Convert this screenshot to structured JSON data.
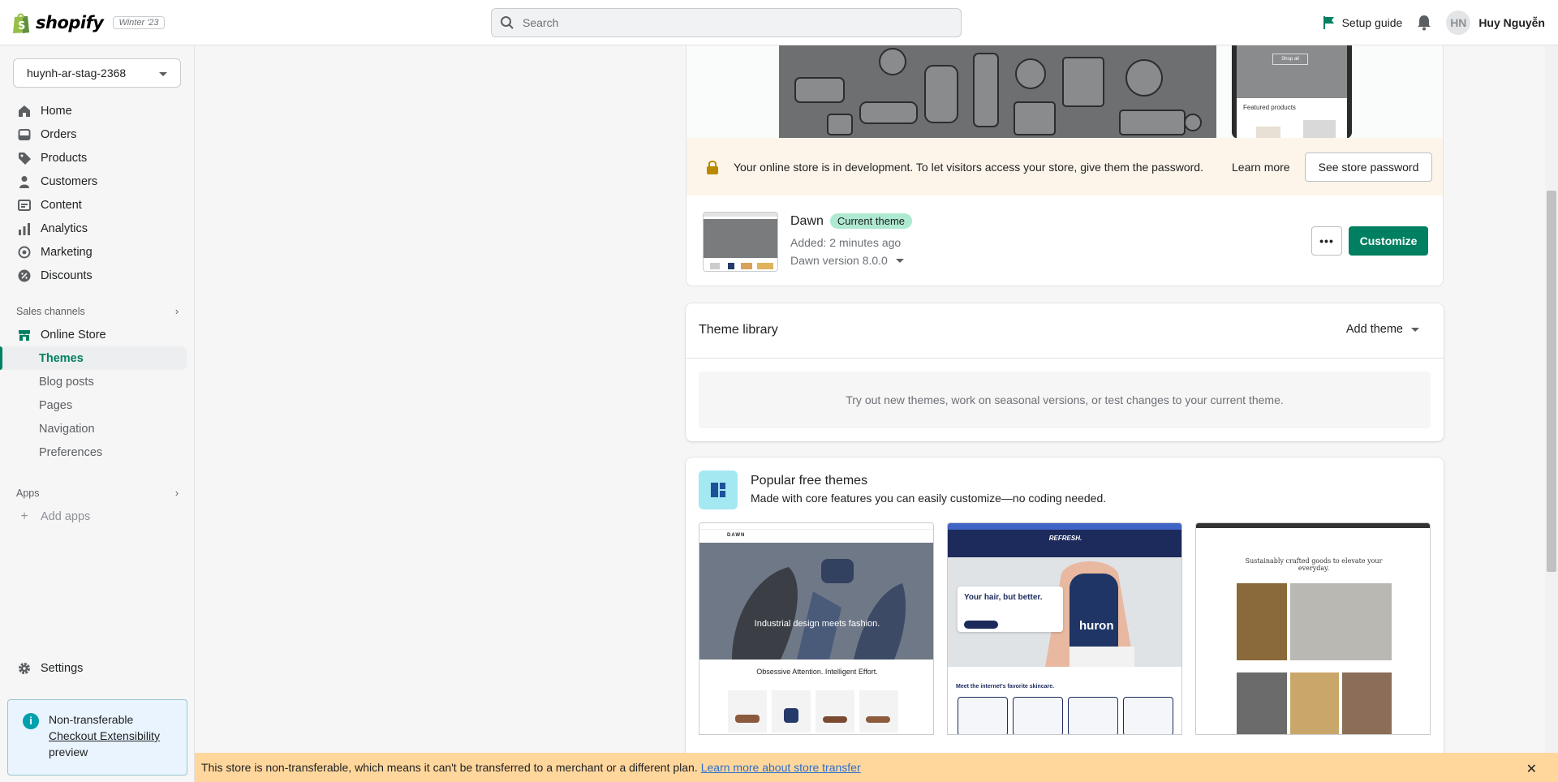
{
  "topbar": {
    "brand": "shopify",
    "edition": "Winter '23",
    "search_placeholder": "Search",
    "setup_guide": "Setup guide",
    "user_initials": "HN",
    "user_name": "Huy Nguyễn"
  },
  "sidebar": {
    "store_name": "huynh-ar-stag-2368",
    "items": [
      {
        "label": "Home",
        "icon": "home-icon"
      },
      {
        "label": "Orders",
        "icon": "orders-icon"
      },
      {
        "label": "Products",
        "icon": "tag-icon"
      },
      {
        "label": "Customers",
        "icon": "person-icon"
      },
      {
        "label": "Content",
        "icon": "content-icon"
      },
      {
        "label": "Analytics",
        "icon": "bar-chart-icon"
      },
      {
        "label": "Marketing",
        "icon": "target-icon"
      },
      {
        "label": "Discounts",
        "icon": "discount-icon"
      }
    ],
    "sales_channels_label": "Sales channels",
    "online_store": "Online Store",
    "sub_items": [
      "Themes",
      "Blog posts",
      "Pages",
      "Navigation",
      "Preferences"
    ],
    "apps_label": "Apps",
    "add_apps": "Add apps",
    "settings": "Settings",
    "notice": {
      "line1": "Non-transferable",
      "link": "Checkout Extensibility",
      "line3": "preview"
    }
  },
  "main": {
    "preview": {
      "mobile_button": "Shop all",
      "mobile_featured": "Featured products"
    },
    "dev_banner": {
      "message": "Your online store is in development. To let visitors access your store, give them the password.",
      "learn_more": "Learn more",
      "button": "See store password"
    },
    "current_theme": {
      "name": "Dawn",
      "badge": "Current theme",
      "added": "Added: 2 minutes ago",
      "version": "Dawn version 8.0.0",
      "customize": "Customize"
    },
    "library": {
      "title": "Theme library",
      "add_theme": "Add theme",
      "empty_text": "Try out new themes, work on seasonal versions, or test changes to your current theme."
    },
    "popular": {
      "title": "Popular free themes",
      "subtitle": "Made with core features you can easily customize—no coding needed.",
      "themes": [
        {
          "brand": "DAWN",
          "headline": "Industrial design meets fashion.",
          "tagline": "Obsessive Attention. Intelligent Effort."
        },
        {
          "brand": "REFRESH.",
          "headline": "Your hair, but better.",
          "product": "huron",
          "tagline": "Meet the internet's favorite skincare."
        },
        {
          "headline": "Sustainably crafted goods to elevate your everyday."
        }
      ]
    }
  },
  "bottom_banner": {
    "text": "This store is non-transferable, which means it can't be transferred to a merchant or a different plan.",
    "link": "Learn more about store transfer"
  },
  "colors": {
    "accent": "#008060",
    "banner": "#ffd79d",
    "dev_banner": "#fdf5ea"
  }
}
